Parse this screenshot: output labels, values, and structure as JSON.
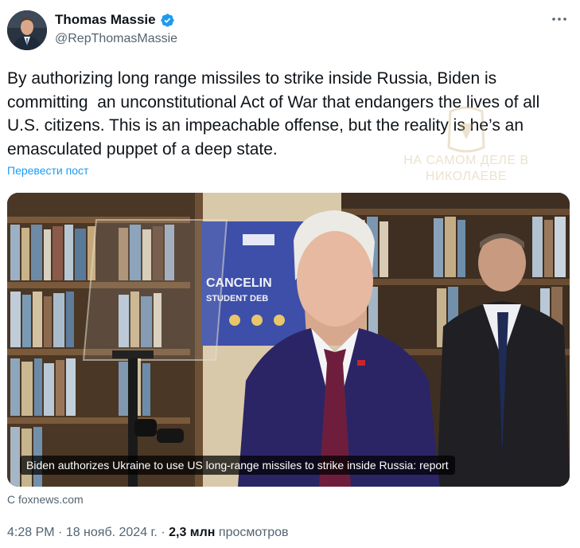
{
  "author": {
    "display_name": "Thomas Massie",
    "handle": "@RepThomasMassie",
    "verified_icon": "verified-badge-icon"
  },
  "more_icon": "more-options-icon",
  "tweet": {
    "text": "By authorizing long range missiles to strike inside Russia, Biden is committing  an unconstitutional Act of War that endangers the lives of all U.S. citizens. This is an impeachable offense, but the reality is he’s an emasculated puppet of a deep state.",
    "translate_label": "Перевести пост"
  },
  "watermark": {
    "text": "НА САМОМ ДЕЛЕ В НИКОЛАЕВЕ"
  },
  "media": {
    "caption": "Biden authorizes Ukraine to use US long-range missiles to strike inside Russia: report",
    "background_sign_text": "CANCELIN STUDENT DEB",
    "source": "С foxnews.com"
  },
  "meta": {
    "time": "4:28 PM",
    "separator": " · ",
    "date": "18 нояб. 2024 г.",
    "views_count": "2,3 млн",
    "views_label": " просмотров"
  },
  "colors": {
    "accent": "#1d9bf0",
    "secondary_text": "#536471",
    "primary_text": "#0f1419"
  }
}
